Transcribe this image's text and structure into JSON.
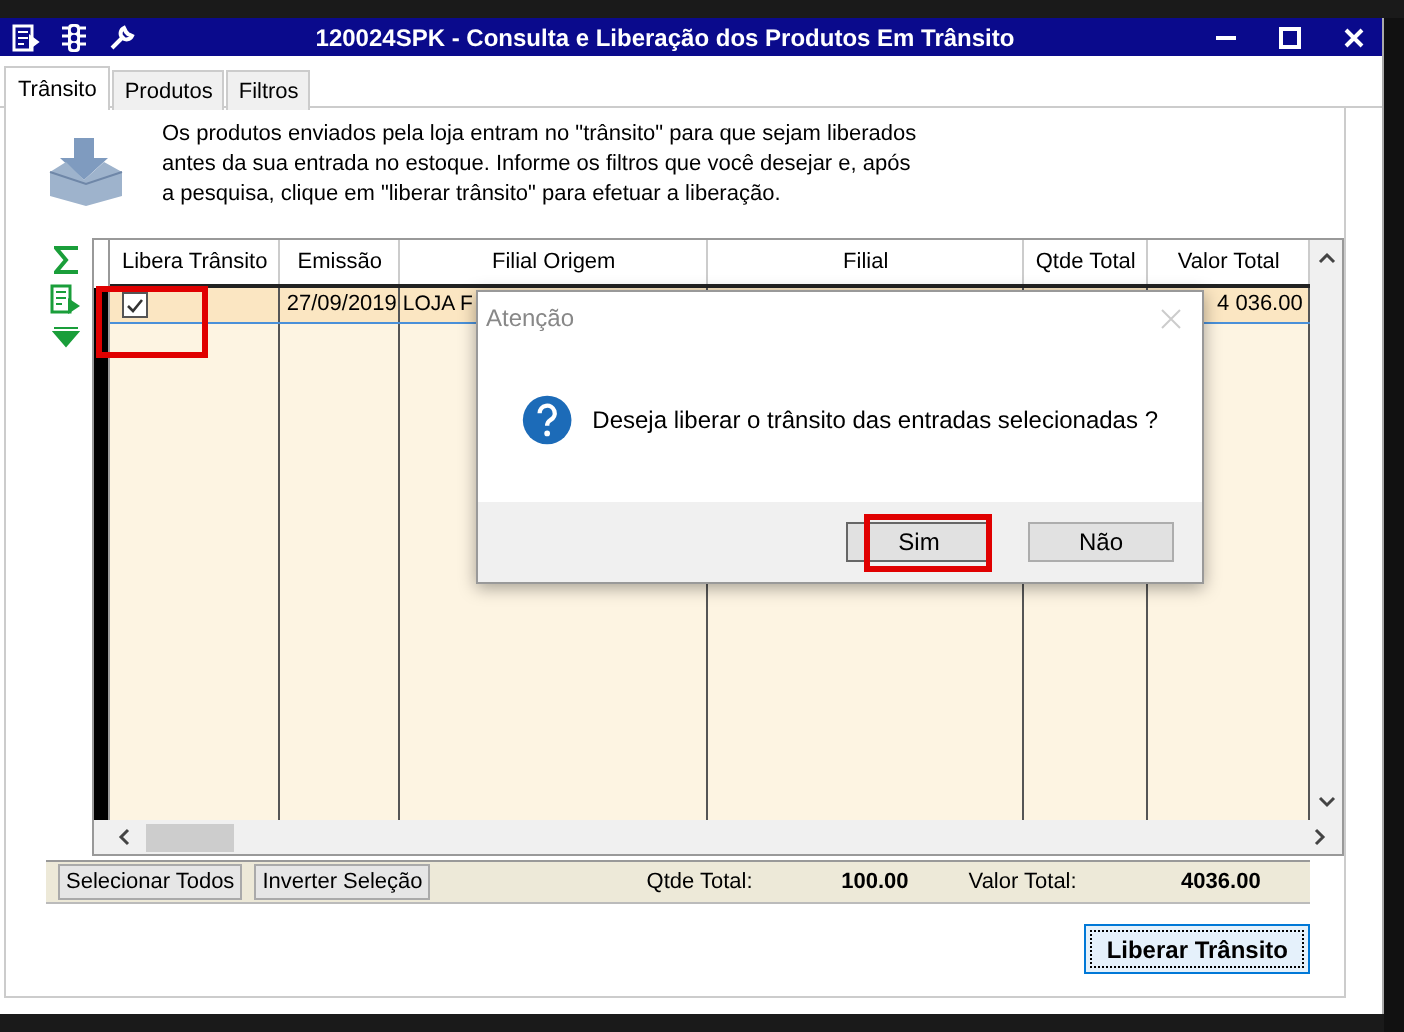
{
  "window": {
    "title": "120024SPK - Consulta e Liberação dos Produtos Em Trânsito"
  },
  "tabs": [
    {
      "label": "Trânsito",
      "selected": true
    },
    {
      "label": "Produtos",
      "selected": false
    },
    {
      "label": "Filtros",
      "selected": false
    }
  ],
  "intro": "Os produtos enviados pela loja entram no \"trânsito\" para que sejam liberados antes da sua entrada no estoque. Informe os filtros que você desejar e, após a pesquisa, clique em \"liberar trânsito\" para efetuar a liberação.",
  "table": {
    "columns": [
      "Libera Trânsito",
      "Emissão",
      "Filial Origem",
      "Filial",
      "Qtde Total",
      "Valor Total"
    ],
    "rows": [
      {
        "checked": true,
        "selected": true,
        "emissao": "27/09/2019",
        "filial_origem": "LOJA F",
        "valor_total": "4 036.00"
      }
    ]
  },
  "footer": {
    "buttons": [
      "Selecionar Todos",
      "Inverter Seleção"
    ],
    "qtde_label": "Qtde Total:",
    "qtde_value": "100.00",
    "valor_label": "Valor Total:",
    "valor_value": "4036.00"
  },
  "action_button": "Liberar Trânsito",
  "dialog": {
    "title": "Atenção",
    "message": "Deseja liberar o trânsito das entradas selecionadas ?",
    "buttons": [
      {
        "label": "Sim",
        "focused": true
      },
      {
        "label": "Não",
        "focused": false
      }
    ]
  }
}
